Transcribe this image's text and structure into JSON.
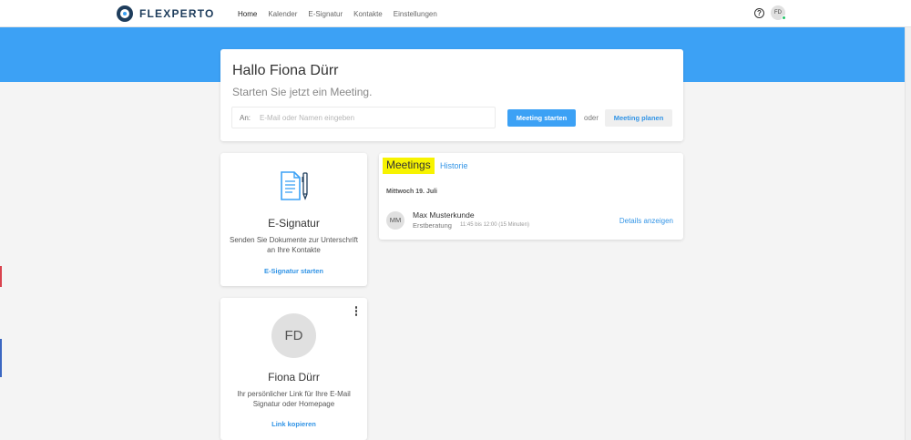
{
  "brand": {
    "name": "FLEXPERTO"
  },
  "nav": {
    "items": [
      {
        "label": "Home",
        "active": true
      },
      {
        "label": "Kalender",
        "active": false
      },
      {
        "label": "E-Signatur",
        "active": false
      },
      {
        "label": "Kontakte",
        "active": false
      },
      {
        "label": "Einstellungen",
        "active": false
      }
    ]
  },
  "header": {
    "help_icon": "?",
    "user_initials": "FD"
  },
  "colors": {
    "primary": "#3ca1f5",
    "link": "#3294e6",
    "highlight": "#f7f300",
    "online": "#27c46b",
    "brand_dark": "#1e3d5c"
  },
  "greeting": {
    "title": "Hallo Fiona Dürr",
    "subtitle": "Starten Sie jetzt ein Meeting.",
    "to_label": "An:",
    "input_placeholder": "E-Mail oder Namen eingeben",
    "input_value": "",
    "start_button": "Meeting starten",
    "or_text": "oder",
    "plan_button": "Meeting planen"
  },
  "esignatur_card": {
    "icon": "document-pen-icon",
    "title": "E-Signatur",
    "description": "Senden Sie Dokumente zur Unterschrift an Ihre Kontakte",
    "link": "E-Signatur starten"
  },
  "profile_card": {
    "initials": "FD",
    "name": "Fiona Dürr",
    "description": "Ihr persönlicher Link für Ihre E-Mail Signatur oder Homepage",
    "link": "Link kopieren",
    "menu_icon": "kebab-menu-icon"
  },
  "meetings_card": {
    "tabs": [
      {
        "label": "Meetings",
        "active": true
      },
      {
        "label": "Historie",
        "active": false
      }
    ],
    "date_header": "Mittwoch 19. Juli",
    "items": [
      {
        "initials": "MM",
        "name": "Max Musterkunde",
        "type": "Erstberatung",
        "time": "11:45 bis 12:00 (15 Minuten)",
        "action": "Details anzeigen"
      }
    ]
  }
}
